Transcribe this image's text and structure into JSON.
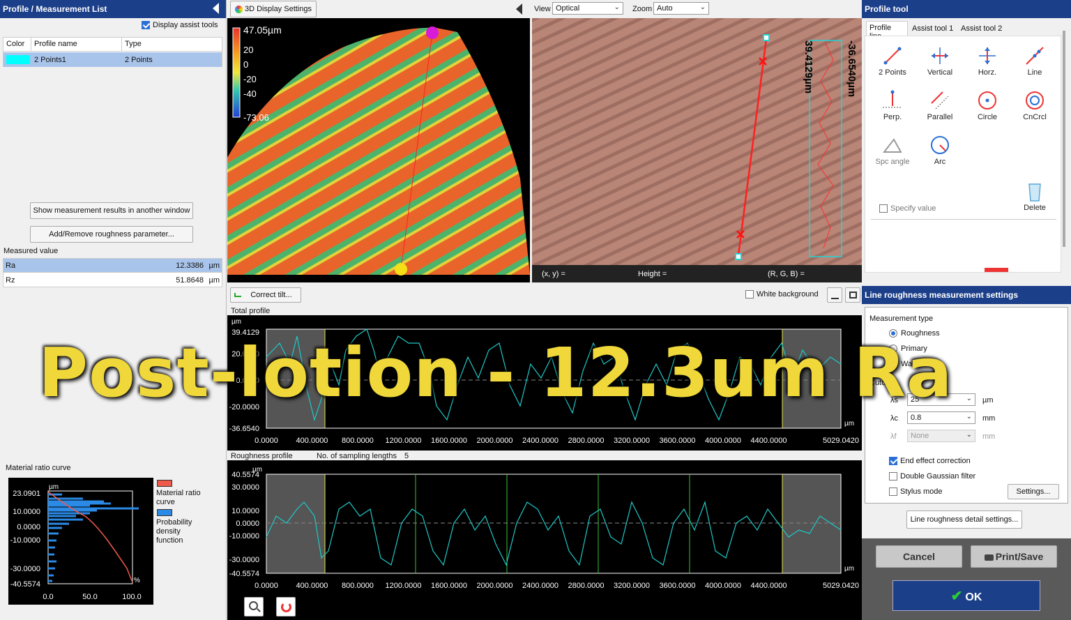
{
  "left": {
    "title": "Profile / Measurement List",
    "assist_label": "Display assist tools",
    "table_headers": [
      "Color",
      "Profile name",
      "Type"
    ],
    "row": {
      "name": "2 Points1",
      "type": "2 Points",
      "color": "#00ffff"
    },
    "btn_show": "Show measurement results in another window",
    "btn_add": "Add/Remove roughness parameter...",
    "measured_label": "Measured value",
    "measured": [
      {
        "name": "Ra",
        "value": "12.3386",
        "unit": "µm"
      },
      {
        "name": "Rz",
        "value": "51.8648",
        "unit": "µm"
      }
    ],
    "mrc_title": "Material ratio curve",
    "mrc_yticks": [
      "23.0901",
      "10.0000",
      "0.0000",
      "-10.0000",
      "-30.0000",
      "-40.5574"
    ],
    "mrc_xticks": [
      "0.0",
      "50.0",
      "100.0"
    ],
    "mrc_unit": "µm",
    "mrc_pct": "%",
    "legend": [
      {
        "label": "Material ratio curve",
        "color": "#f05a4a"
      },
      {
        "label": "Probability density function",
        "color": "#2a8ae6"
      }
    ]
  },
  "display3d": {
    "button": "3D Display Settings",
    "scale": [
      "47.05µm",
      "20",
      "0",
      "-20",
      "-40",
      "-73.06"
    ]
  },
  "optical": {
    "view_label": "View",
    "view_value": "Optical",
    "zoom_label": "Zoom",
    "zoom_value": "Auto",
    "readout": {
      "xy": "(x, y)  =",
      "height": "Height  =",
      "rgb": "(R, G, B)  ="
    },
    "profile_max": "39.4129µm",
    "profile_min": "-36.6540µm"
  },
  "banner": "Post-lotion - 12.3um Ra",
  "correct_tilt": "Correct tilt...",
  "white_bg": "White background",
  "total": {
    "title": "Total profile",
    "unit_y": "µm",
    "unit_x": "µm",
    "yticks": [
      "39.4129",
      "20.0000",
      "0.0000",
      "-20.0000",
      "-36.6540"
    ],
    "xticks": [
      "0.0000",
      "400.0000",
      "800.0000",
      "1200.0000",
      "1600.0000",
      "2000.0000",
      "2400.0000",
      "2800.0000",
      "3200.0000",
      "3600.0000",
      "4000.0000",
      "4400.0000",
      "5029.0420"
    ]
  },
  "roughness": {
    "title": "Roughness profile",
    "sampling_label": "No. of sampling lengths",
    "sampling_value": "5",
    "unit_y": "µm",
    "unit_x": "µm",
    "yticks": [
      "40.5574",
      "30.0000",
      "10.0000",
      "0.0000",
      "-10.0000",
      "-30.0000",
      "-40.5574"
    ],
    "xticks": [
      "0.0000",
      "400.0000",
      "800.0000",
      "1200.0000",
      "1600.0000",
      "2000.0000",
      "2400.0000",
      "2800.0000",
      "3200.0000",
      "3600.0000",
      "4000.0000",
      "4400.0000",
      "5029.0420"
    ]
  },
  "profile_tool": {
    "title": "Profile tool",
    "tabs": [
      "Profile line",
      "Assist tool 1",
      "Assist tool 2"
    ],
    "tools": [
      "2 Points",
      "Vertical",
      "Horz.",
      "Line",
      "Perp.",
      "Parallel",
      "Circle",
      "CnCrcl",
      "Spc angle",
      "Arc"
    ],
    "specify": "Specify value",
    "delete": "Delete"
  },
  "settings": {
    "title": "Line roughness measurement settings",
    "type_label": "Measurement type",
    "types": [
      "Roughness",
      "Primary",
      "Waviness"
    ],
    "cutoff": "Cutoff",
    "ls_label": "λs",
    "ls_value": "25",
    "ls_unit": "µm",
    "lc_label": "λc",
    "lc_value": "0.8",
    "lc_unit": "mm",
    "lf_label": "λf",
    "lf_value": "None",
    "lf_unit": "mm",
    "end_effect": "End effect correction",
    "double_gauss": "Double Gaussian filter",
    "stylus": "Stylus mode",
    "settings_btn": "Settings...",
    "detail_btn": "Line roughness detail settings...",
    "cancel": "Cancel",
    "print": "Print/Save",
    "ok": "OK"
  }
}
